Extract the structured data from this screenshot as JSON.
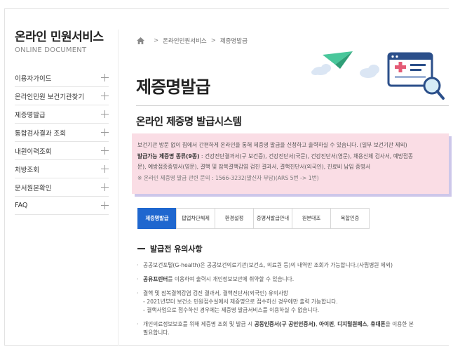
{
  "sidebar": {
    "title": "온라인 민원서비스",
    "subtitle": "ONLINE DOCUMENT",
    "items": [
      {
        "label": "이용자가이드"
      },
      {
        "label": "온라인민원 보건기관찾기"
      },
      {
        "label": "제증명발급"
      },
      {
        "label": "통합검사결과 조회"
      },
      {
        "label": "내원이력조회"
      },
      {
        "label": "처방조회"
      },
      {
        "label": "문서원본확인"
      },
      {
        "label": "FAQ"
      }
    ]
  },
  "breadcrumb": {
    "level1": "온라인민원서비스",
    "level2": "제증명발급",
    "separator": ">"
  },
  "page": {
    "title": "제증명발급",
    "section_title": "온라인 제증명 발급시스템"
  },
  "infobox": {
    "line1": "보건기관 방문 없이 집에서 간편하게 온라인을 통해 제증명 발급을 신청하고 출력하실 수 있습니다. (일부 보건기관 제외)",
    "line2_bold": "발급가능 제증명 종류(9종)",
    "line2_rest": " : 건강진단결과서(구 보건증), 건강진단서(국문), 건강진단서(영문), 채용신체 검사서, 예방접종",
    "line3": "문), 예방접종증명서(영문), 결핵 및 잠복결핵감염 검진 결과서, 결핵진단서(외국인), 진료비 납입 증명서",
    "line4": "※ 온라인 제증명 발급 관련 문의 : 1566-3232(발신자 부담)(ARS 5번 -> 1번)"
  },
  "tabs": [
    {
      "label": "제증명발급"
    },
    {
      "label": "팝업차단해제"
    },
    {
      "label": "환경설정"
    },
    {
      "label": "증명서발급안내"
    },
    {
      "label": "원본대조"
    },
    {
      "label": "복합인증"
    }
  ],
  "notice": {
    "title": "발급전 유의사항",
    "item1": "공공보건포털(G-health)은 공공보건의료기관(보건소, 의료원 등)의 내역만 조회가 가능합니다.(사립병원 제외)",
    "item2_bold": "공유프린터",
    "item2_rest": "를 이용하여 출력시 개인정보보안에 취약할 수 있습니다.",
    "item3_l1": "결핵 및 잠복결핵감염 검진 결과서, 결핵진단서(외국인) 유의사항",
    "item3_l2": "- 2021년부터 보건소 민원접수실에서 제증명으로 접수하신 경우에만 출력 가능합니다.",
    "item3_l3": "- 결핵사업으로 접수하신 경우에는 제증명 발급서비스를 이용하실 수 없습니다.",
    "item4_a": "개인의료정보보호를 위해 제증명 조회 및 발급 시 ",
    "item4_b1": "공동인증서(구 공인인증서)",
    "item4_sep1": ", ",
    "item4_b2": "아이핀",
    "item4_sep2": ", ",
    "item4_b3": "디지털원패스",
    "item4_sep3": ", ",
    "item4_b4": "휴대폰",
    "item4_c": "을 이용한 본",
    "item4_l2": "필요합니다."
  },
  "colors": {
    "accent": "#1f67cf",
    "info_bg": "#fadde5",
    "info_shadow": "#cdc7ea",
    "plane": "#49c79b",
    "illustration_blue": "#2b4f8a"
  }
}
